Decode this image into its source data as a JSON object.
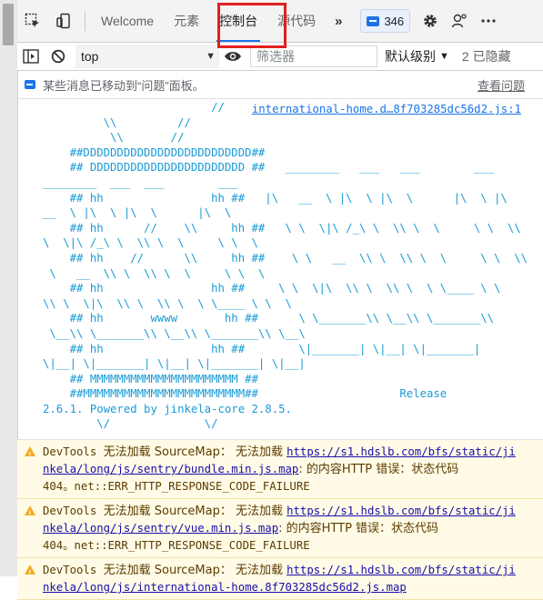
{
  "toolbar": {
    "tabs": [
      {
        "label": "Welcome",
        "active": false
      },
      {
        "label": "元素",
        "active": false
      },
      {
        "label": "控制台",
        "active": true
      },
      {
        "label": "源代码",
        "active": false
      }
    ],
    "more_tabs": "»",
    "issues_count": "346"
  },
  "filterbar": {
    "context": "top",
    "filter_placeholder": "筛选器",
    "levels_label": "默认级别",
    "hidden_label": "2 已隐藏"
  },
  "notice": {
    "text": "某些消息已移动到“问题”面板。",
    "link": "查看问题"
  },
  "console": {
    "source_link": "international-home.d…8f703285dc56d2.js:1",
    "ascii_art": "                         //\n         \\\\         //\n          \\\\       //\n    ##DDDDDDDDDDDDDDDDDDDDDDDDD##\n    ## DDDDDDDDDDDDDDDDDDDDDDD ##   ________   ___   ___        ___\n________  ___  ___        ___\n    ## hh                hh ##   |\\   __  \\ |\\  \\ |\\  \\      |\\  \\ |\\\n__  \\ |\\  \\ |\\  \\      |\\  \\\n    ## hh      //    \\\\     hh ##   \\ \\  \\|\\ /_\\ \\  \\\\ \\  \\     \\ \\  \\\\\n\\  \\|\\ /_\\ \\  \\\\ \\  \\     \\ \\  \\\n    ## hh    //      \\\\     hh ##    \\ \\   __  \\\\ \\  \\\\ \\  \\     \\ \\  \\\\\n \\   __  \\\\ \\  \\\\ \\  \\     \\ \\  \\\n    ## hh                hh ##     \\ \\  \\|\\  \\\\ \\  \\\\ \\  \\ \\____ \\ \\\n\\\\ \\  \\|\\  \\\\ \\  \\\\ \\  \\ \\____ \\ \\  \\\n    ## hh       wwww       hh ##      \\ \\_______\\\\ \\__\\\\ \\_______\\\\\n \\__\\\\ \\_______\\\\ \\__\\\\ \\_______\\\\ \\__\\\n    ## hh                hh ##        \\|_______| \\|__| \\|_______|\n\\|__| \\|_______| \\|__| \\|_______| \\|__|\n    ## MMMMMMMMMMMMMMMMMMMMMM ##\n    ##MMMMMMMMMMMMMMMMMMMMMMMM##                     Release\n2.6.1. Powered by jinkela-core 2.8.5.\n        \\/              \\/",
    "warnings": [
      {
        "prefix": "DevTools ",
        "msg1": "无法加载 SourceMap：",
        "msg2": " 无法加载 ",
        "url": "https://s1.hdslb.com/bfs/static/jinkela/long/js/sentry/bundle.min.js.map",
        "msg3": ": 的内容HTTP 错误：状态代码",
        "code": "404。net::ERR_HTTP_RESPONSE_CODE_FAILURE"
      },
      {
        "prefix": "DevTools ",
        "msg1": "无法加载 SourceMap：",
        "msg2": " 无法加载 ",
        "url": "https://s1.hdslb.com/bfs/static/jinkela/long/js/sentry/vue.min.js.map",
        "msg3": ": 的内容HTTP 错误：状态代码",
        "code": "404。net::ERR_HTTP_RESPONSE_CODE_FAILURE"
      },
      {
        "prefix": "DevTools ",
        "msg1": "无法加载 SourceMap：",
        "msg2": " 无法加载 ",
        "url": "https://s1.hdslb.com/bfs/static/jinkela/long/js/international-home.8f703285dc56d2.js.map",
        "msg3": "",
        "code": ""
      }
    ]
  },
  "colors": {
    "accent": "#1a73e8",
    "highlight_box": "#e02020",
    "ascii_art": "#1a9bd7",
    "warning_bg": "#fffbe6"
  }
}
